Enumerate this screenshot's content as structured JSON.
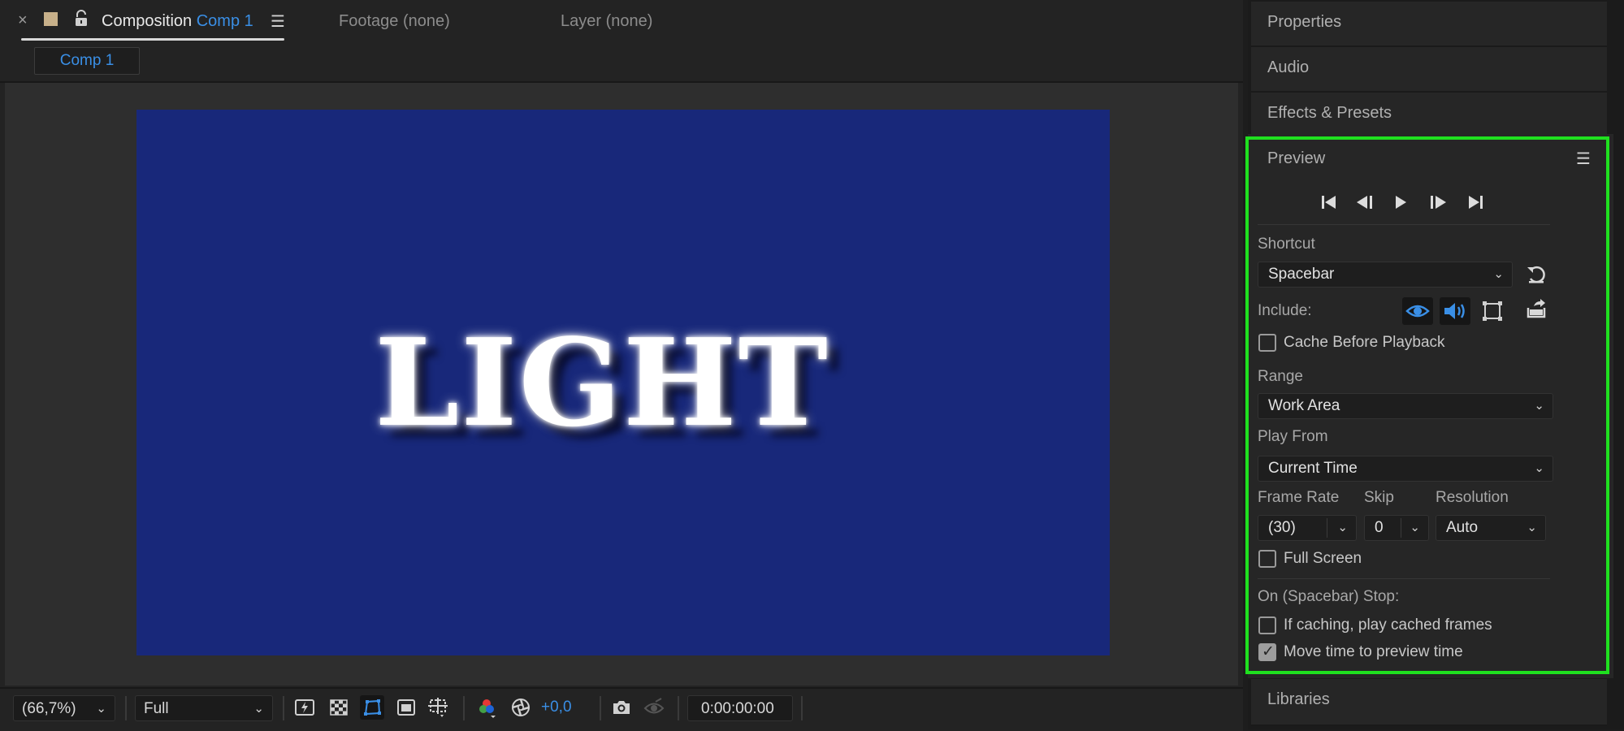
{
  "composition_panel": {
    "tab_label": "Composition",
    "tab_comp_name": "Comp 1",
    "footage_tab": "Footage (none)",
    "layer_tab": "Layer (none)",
    "comp_chip": "Comp 1",
    "canvas_text": "LIGHT",
    "colors": {
      "canvas": "#18287a",
      "accent": "#3a8fe6"
    }
  },
  "bottom_toolbar": {
    "zoom": "(66,7%)",
    "resolution": "Full",
    "exposure": "+0,0",
    "timecode": "0:00:00:00",
    "icons": [
      "fast-previews-icon",
      "transparency-grid-icon",
      "mask-path-icon",
      "region-of-interest-icon",
      "guides-icon",
      "color-channels-icon",
      "color-management-icon",
      "snapshot-icon",
      "show-snapshot-icon"
    ]
  },
  "right_panels": {
    "properties": "Properties",
    "audio": "Audio",
    "effects_presets": "Effects & Presets",
    "libraries": "Libraries"
  },
  "preview": {
    "title": "Preview",
    "shortcut_label": "Shortcut",
    "shortcut_value": "Spacebar",
    "include_label": "Include:",
    "cache_before_playback": "Cache Before Playback",
    "range_label": "Range",
    "range_value": "Work Area",
    "play_from_label": "Play From",
    "play_from_value": "Current Time",
    "frame_rate_label": "Frame Rate",
    "frame_rate_value": "(30)",
    "skip_label": "Skip",
    "skip_value": "0",
    "resolution_label": "Resolution",
    "resolution_value": "Auto",
    "full_screen": "Full Screen",
    "on_stop_label": "On (Spacebar) Stop:",
    "if_caching": "If caching, play cached frames",
    "move_time": "Move time to preview time",
    "checks": {
      "cache_before_playback": false,
      "full_screen": false,
      "if_caching": false,
      "move_time": true
    },
    "highlight_color": "#1fe01f"
  }
}
